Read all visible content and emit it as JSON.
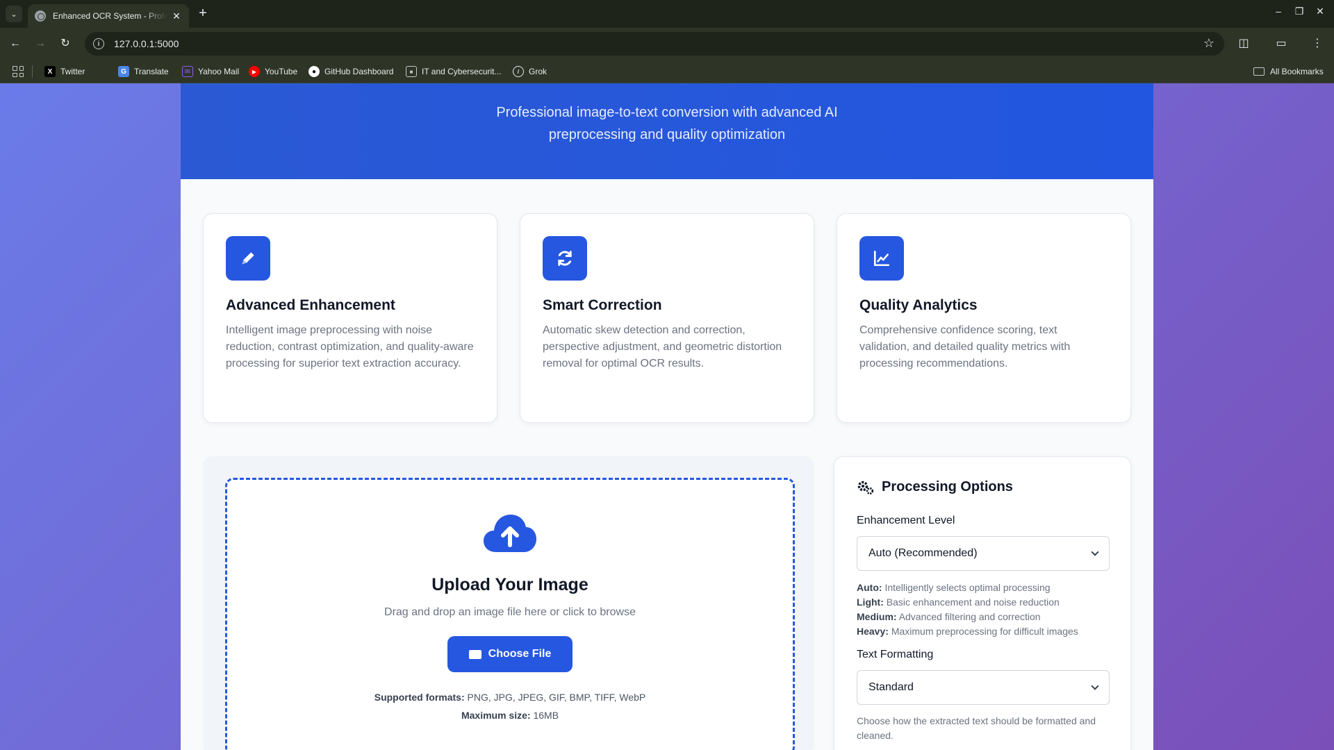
{
  "browser": {
    "tab_title": "Enhanced OCR System - Professional",
    "url": "127.0.0.1:5000",
    "bookmarks": [
      {
        "label": "Twitter",
        "icon": "x-logo-icon"
      },
      {
        "label": "Translate",
        "icon": "translate-icon"
      },
      {
        "label": "Yahoo Mail",
        "icon": "mail-icon"
      },
      {
        "label": "YouTube",
        "icon": "youtube-icon"
      },
      {
        "label": "GitHub Dashboard",
        "icon": "github-icon"
      },
      {
        "label": "IT and Cybersecurit...",
        "icon": "site-icon"
      },
      {
        "label": "Grok",
        "icon": "grok-icon"
      }
    ],
    "all_bookmarks": "All Bookmarks"
  },
  "hero": {
    "subtitle": "Professional image-to-text conversion with advanced AI preprocessing and quality optimization"
  },
  "features": [
    {
      "title": "Advanced Enhancement",
      "icon": "pencil-icon",
      "description": "Intelligent image preprocessing with noise reduction, contrast optimization, and quality-aware processing for superior text extraction accuracy."
    },
    {
      "title": "Smart Correction",
      "icon": "sync-icon",
      "description": "Automatic skew detection and correction, perspective adjustment, and geometric distortion removal for optimal OCR results."
    },
    {
      "title": "Quality Analytics",
      "icon": "chart-line-icon",
      "description": "Comprehensive confidence scoring, text validation, and detailed quality metrics with processing recommendations."
    }
  ],
  "upload": {
    "title": "Upload Your Image",
    "subtitle": "Drag and drop an image file here or click to browse",
    "button": "Choose File",
    "formats_label": "Supported formats:",
    "formats_value": "PNG, JPG, JPEG, GIF, BMP, TIFF, WebP",
    "size_label": "Maximum size:",
    "size_value": "16MB"
  },
  "options": {
    "title": "Processing Options",
    "enhancement_label": "Enhancement Level",
    "enhancement_value": "Auto (Recommended)",
    "levels": [
      {
        "name": "Auto:",
        "desc": "Intelligently selects optimal processing"
      },
      {
        "name": "Light:",
        "desc": "Basic enhancement and noise reduction"
      },
      {
        "name": "Medium:",
        "desc": "Advanced filtering and correction"
      },
      {
        "name": "Heavy:",
        "desc": "Maximum preprocessing for difficult images"
      }
    ],
    "formatting_label": "Text Formatting",
    "formatting_value": "Standard",
    "formatting_help": "Choose how the extracted text should be formatted and cleaned."
  },
  "colors": {
    "accent": "#2557e0",
    "hero": "#2b59d4"
  }
}
